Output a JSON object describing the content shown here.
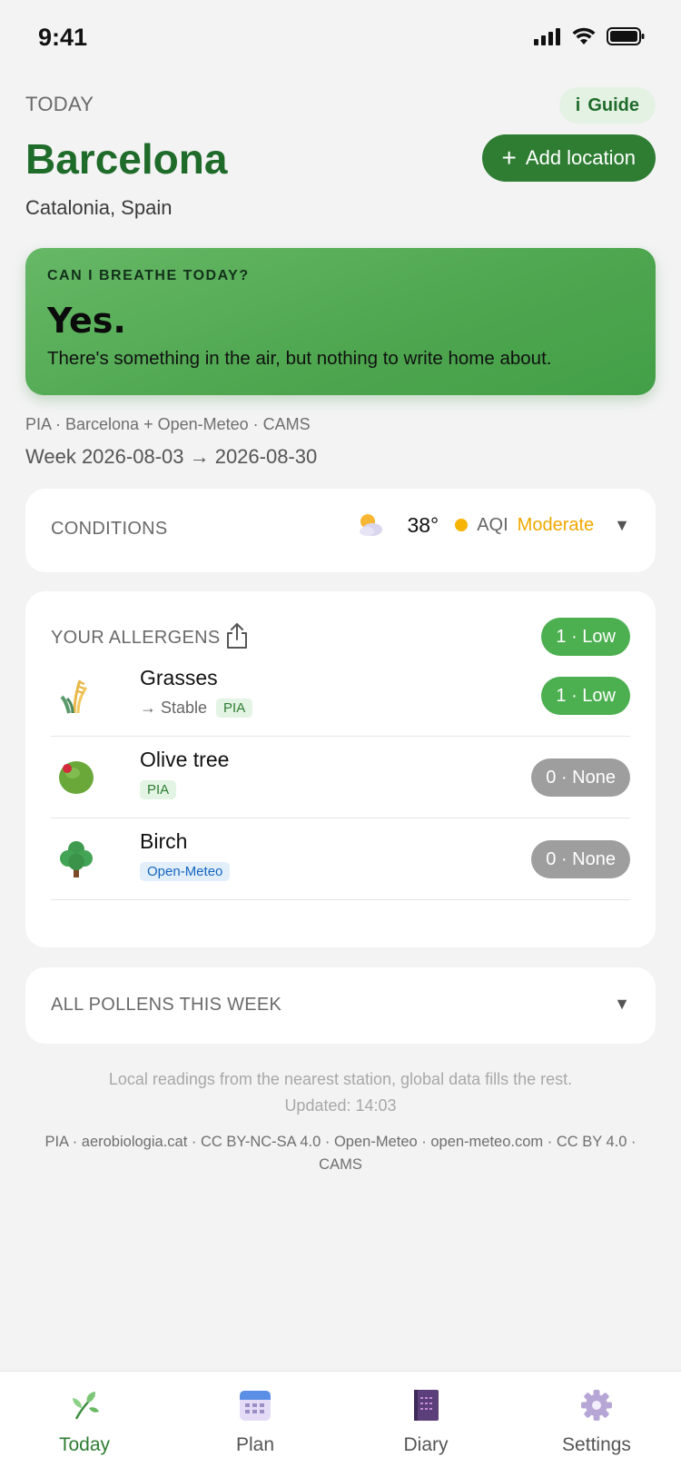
{
  "status_bar": {
    "time": "9:41"
  },
  "header": {
    "today_label": "TODAY",
    "city": "Barcelona",
    "region": "Catalonia, Spain",
    "guide_icon": "i",
    "guide_label": "Guide",
    "add_location_label": "Add location"
  },
  "breathe": {
    "question": "CAN I BREATHE TODAY?",
    "answer": "Yes.",
    "message": "There's something in the air, but nothing to write home about."
  },
  "sources_line": "PIA · Barcelona + Open-Meteo · CAMS",
  "week_line": "Week 2026-08-03 → 2026-08-30",
  "conditions": {
    "title": "CONDITIONS",
    "temperature": "38°",
    "aqi_label": "AQI",
    "aqi_value": "Moderate",
    "weather_icon": "partly-cloudy-icon"
  },
  "allergens": {
    "title": "YOUR ALLERGENS",
    "summary": "1 · Low",
    "items": [
      {
        "name": "Grasses",
        "trend": "→ Stable",
        "source": "PIA",
        "level": "1 · Low",
        "icon": "grass-icon"
      },
      {
        "name": "Olive tree",
        "trend": "",
        "source": "PIA",
        "level": "0 · None",
        "icon": "olive-icon"
      },
      {
        "name": "Birch",
        "trend": "",
        "source": "Open-Meteo",
        "level": "0 · None",
        "icon": "tree-icon"
      }
    ]
  },
  "all_pollens": {
    "title": "ALL POLLENS THIS WEEK"
  },
  "footer": {
    "note": "Local readings from the nearest station, global data fills the rest.",
    "updated": "Updated: 14:03",
    "credits": "PIA · aerobiologia.cat · CC BY-NC-SA 4.0 · Open-Meteo · open-meteo.com · CC BY 4.0 · CAMS"
  },
  "tabs": [
    {
      "label": "Today",
      "icon": "sprout-icon",
      "active": true
    },
    {
      "label": "Plan",
      "icon": "calendar-icon",
      "active": false
    },
    {
      "label": "Diary",
      "icon": "notebook-icon",
      "active": false
    },
    {
      "label": "Settings",
      "icon": "gear-icon",
      "active": false
    }
  ],
  "colors": {
    "accent": "#2e7d32",
    "card_green": "#4ea64f",
    "low": "#4caf50",
    "none": "#9e9e9e",
    "aqi_moderate": "#f0a800"
  }
}
